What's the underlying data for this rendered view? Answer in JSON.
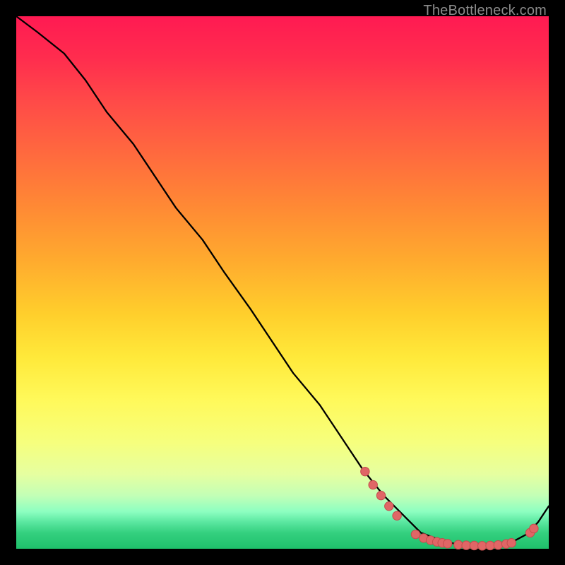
{
  "watermark": "TheBottleneck.com",
  "chart_data": {
    "type": "line",
    "title": "",
    "xlabel": "",
    "ylabel": "",
    "xlim": [
      0,
      100
    ],
    "ylim": [
      0,
      100
    ],
    "series": [
      {
        "name": "curve",
        "x": [
          0,
          4,
          9,
          13,
          17,
          22,
          26,
          30,
          35,
          39,
          44,
          48,
          52,
          57,
          61,
          65,
          69,
          73,
          76,
          80,
          83,
          86,
          88,
          90,
          93,
          96,
          98,
          100
        ],
        "y": [
          100,
          97,
          93,
          88,
          82,
          76,
          70,
          64,
          58,
          52,
          45,
          39,
          33,
          27,
          21,
          15,
          10,
          6,
          3,
          1.5,
          0.8,
          0.5,
          0.5,
          0.6,
          1.2,
          2.8,
          5.0,
          8.0
        ]
      }
    ],
    "points": [
      {
        "x": 65.5,
        "y": 14.5
      },
      {
        "x": 67.0,
        "y": 12.0
      },
      {
        "x": 68.5,
        "y": 10.0
      },
      {
        "x": 70.0,
        "y": 8.0
      },
      {
        "x": 71.5,
        "y": 6.2
      },
      {
        "x": 75.0,
        "y": 2.7
      },
      {
        "x": 76.5,
        "y": 2.0
      },
      {
        "x": 77.8,
        "y": 1.6
      },
      {
        "x": 79.0,
        "y": 1.3
      },
      {
        "x": 80.0,
        "y": 1.1
      },
      {
        "x": 81.0,
        "y": 0.95
      },
      {
        "x": 83.0,
        "y": 0.75
      },
      {
        "x": 84.5,
        "y": 0.65
      },
      {
        "x": 86.0,
        "y": 0.6
      },
      {
        "x": 87.5,
        "y": 0.55
      },
      {
        "x": 89.0,
        "y": 0.6
      },
      {
        "x": 90.5,
        "y": 0.7
      },
      {
        "x": 92.0,
        "y": 0.9
      },
      {
        "x": 93.0,
        "y": 1.1
      },
      {
        "x": 96.5,
        "y": 3.0
      },
      {
        "x": 97.2,
        "y": 3.8
      }
    ],
    "colors": {
      "curve": "#000000",
      "point_fill": "#e06666",
      "point_stroke": "#c44d4d"
    }
  }
}
